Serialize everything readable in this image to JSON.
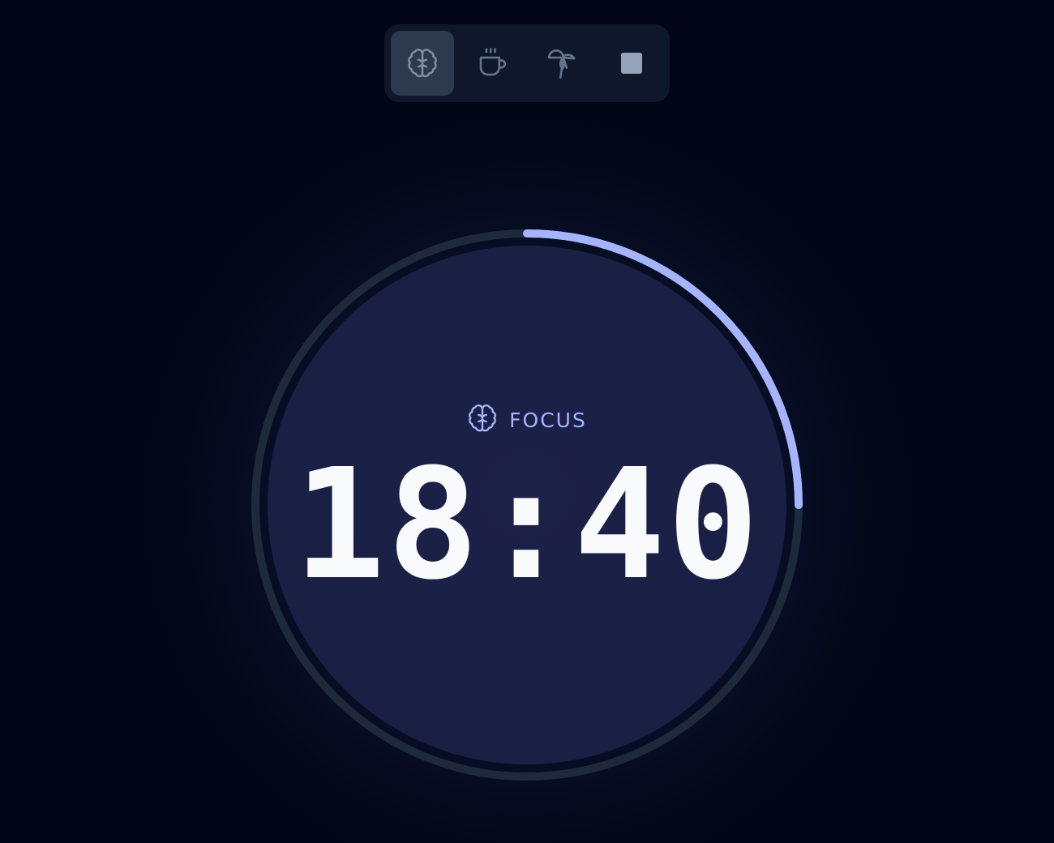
{
  "toolbar": {
    "modes": [
      {
        "name": "focus",
        "icon": "brain-icon",
        "active": true
      },
      {
        "name": "short-break",
        "icon": "coffee-cup-icon",
        "active": false
      },
      {
        "name": "long-break",
        "icon": "palm-tree-icon",
        "active": false
      },
      {
        "name": "stop",
        "icon": "stop-square-icon",
        "active": false
      }
    ]
  },
  "timer": {
    "mode_label": "FOCUS",
    "mode_icon": "brain-icon",
    "time": "18:40",
    "progress": 0.25
  },
  "colors": {
    "background": "#020617",
    "accent": "#a5b4fc",
    "track": "#1e293b",
    "face": "#1a1f45",
    "time_text": "#f8fafc"
  }
}
